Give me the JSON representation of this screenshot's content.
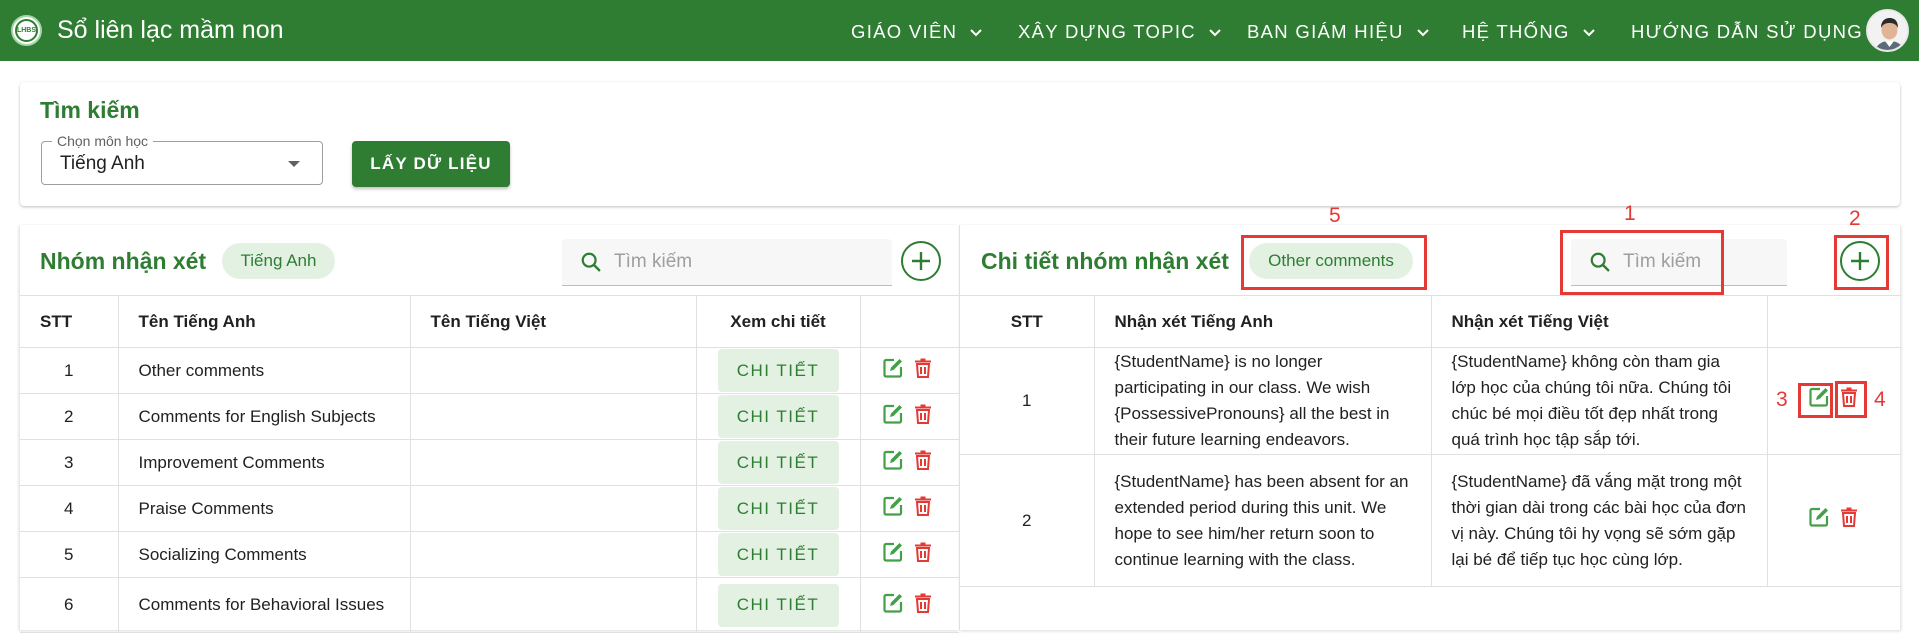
{
  "header": {
    "logo_text": "LHBS",
    "app_title": "Sổ liên lạc mầm non",
    "nav": [
      "GIÁO VIÊN",
      "XÂY DỰNG TOPIC",
      "BAN GIÁM HIỆU",
      "HỆ THỐNG",
      "HƯỚNG DẪN SỬ DỤNG"
    ],
    "nav_icons": [
      "chevron-down-icon",
      "chevron-down-icon",
      "chevron-down-icon",
      "chevron-down-icon",
      ""
    ]
  },
  "search_card": {
    "title": "Tìm kiếm",
    "subject_label": "Chọn môn học",
    "subject_value": "Tiếng Anh",
    "fetch_button": "LẤY DỮ LIỆU"
  },
  "left_panel": {
    "title": "Nhóm nhận xét",
    "chip": "Tiếng Anh",
    "search_placeholder": "Tìm kiếm",
    "columns": [
      "STT",
      "Tên Tiếng Anh",
      "Tên Tiếng Việt",
      "Xem chi tiết",
      ""
    ],
    "detail_label": "CHI TIẾT",
    "rows": [
      {
        "stt": "1",
        "en": "Other comments",
        "vi": ""
      },
      {
        "stt": "2",
        "en": "Comments for English Subjects",
        "vi": ""
      },
      {
        "stt": "3",
        "en": "Improvement Comments",
        "vi": ""
      },
      {
        "stt": "4",
        "en": "Praise Comments",
        "vi": ""
      },
      {
        "stt": "5",
        "en": "Socializing Comments",
        "vi": ""
      },
      {
        "stt": "6",
        "en": "Comments for Behavioral Issues",
        "vi": ""
      }
    ]
  },
  "right_panel": {
    "title": "Chi tiết nhóm nhận xét",
    "chip": "Other comments",
    "search_placeholder": "Tìm kiếm",
    "columns": [
      "STT",
      "Nhận xét Tiếng Anh",
      "Nhận xét Tiếng Việt",
      ""
    ],
    "rows": [
      {
        "stt": "1",
        "en": "{StudentName} is no longer participating in our class. We wish {PossessivePronouns} all the best in their future learning endeavors.",
        "vi": "{StudentName} không còn tham gia lớp học của chúng tôi nữa. Chúng tôi chúc bé mọi điều tốt đẹp nhất trong quá trình học tập sắp tới."
      },
      {
        "stt": "2",
        "en": "{StudentName} has been absent for an extended period during this unit. We hope to see him/her return soon to continue learning with the class.",
        "vi": "{StudentName} đã vắng mặt trong một thời gian dài trong các bài học của đơn vị này. Chúng tôi hy vọng sẽ sớm gặp lại bé để tiếp tục học cùng lớp."
      }
    ]
  },
  "annotations": [
    "1",
    "2",
    "3",
    "4",
    "5"
  ],
  "colors": {
    "primary": "#2e7d32",
    "chip_bg": "#e3f1e3",
    "edit": "#43a047",
    "delete": "#e53935",
    "annotation": "#e53935"
  }
}
